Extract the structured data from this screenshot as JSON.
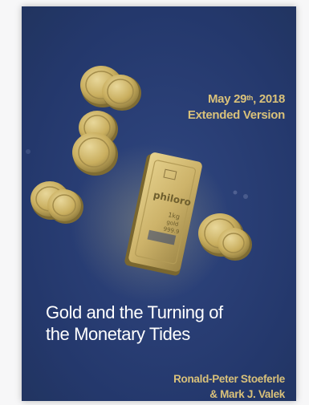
{
  "cover": {
    "date_prefix": "May 29",
    "date_suffix": "th",
    "date_year": ", 2018",
    "edition": "Extended Version",
    "title_line1": "Gold and the Turning of",
    "title_line2": "the Monetary Tides",
    "author_line1": "Ronald-Peter Stoeferle",
    "author_line2": "& Mark J. Valek",
    "bar_brand": "philoro",
    "bar_weight": "1kg",
    "bar_metal": "gold",
    "bar_purity": "999.9",
    "colors": {
      "background": "#24386c",
      "accent_gold": "#d9c17a",
      "title_text": "#ffffff"
    }
  }
}
